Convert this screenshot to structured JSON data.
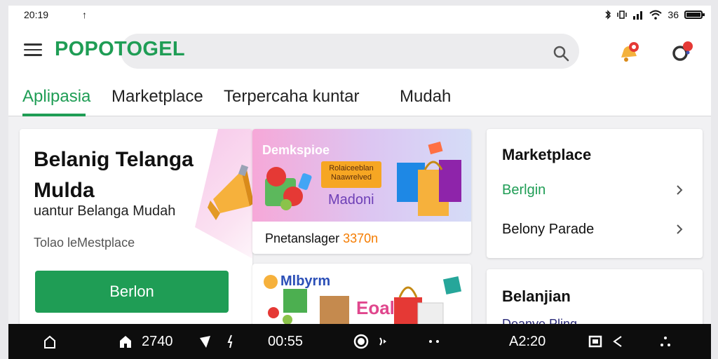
{
  "status": {
    "time": "20:19",
    "left_symbol": "↑",
    "signal_text": "36"
  },
  "app": {
    "brand": "POPOTOGEL",
    "search_placeholder": ""
  },
  "tabs": [
    {
      "label": "Aplipasia",
      "active": true
    },
    {
      "label": "Marketplace",
      "active": false
    },
    {
      "label": "Terpercaha kuntar",
      "active": false
    },
    {
      "label": "Mudah",
      "active": false
    }
  ],
  "hero": {
    "title": "Belanig Telanga Mulda",
    "subtitle": "uantur Belanga Mudah",
    "note": "Tolao leMestplace",
    "button_label": "Berlon"
  },
  "promo1": {
    "banner_title": "Demkspioe",
    "tag_text": "Rolaiceeblan Naawrelved",
    "brand": "Madoni",
    "caption": "Pnetanslager",
    "price": "3370n"
  },
  "promo2": {
    "brand": "Mlbyrm",
    "brand2": "Eoalli"
  },
  "side1": {
    "title": "Marketplace",
    "items": [
      {
        "label": "Berlgin",
        "highlight": true
      },
      {
        "label": "Belony Parade",
        "highlight": false
      }
    ]
  },
  "side2": {
    "title": "Belanjian",
    "subtitle": "Deanye Pling"
  },
  "navbar": {
    "count": "2740",
    "time1": "00:55",
    "time2": "A2:20"
  },
  "colors": {
    "brand_green": "#1f9d55",
    "accent_orange": "#f57c00",
    "promo_purple": "#6d3fb6"
  }
}
